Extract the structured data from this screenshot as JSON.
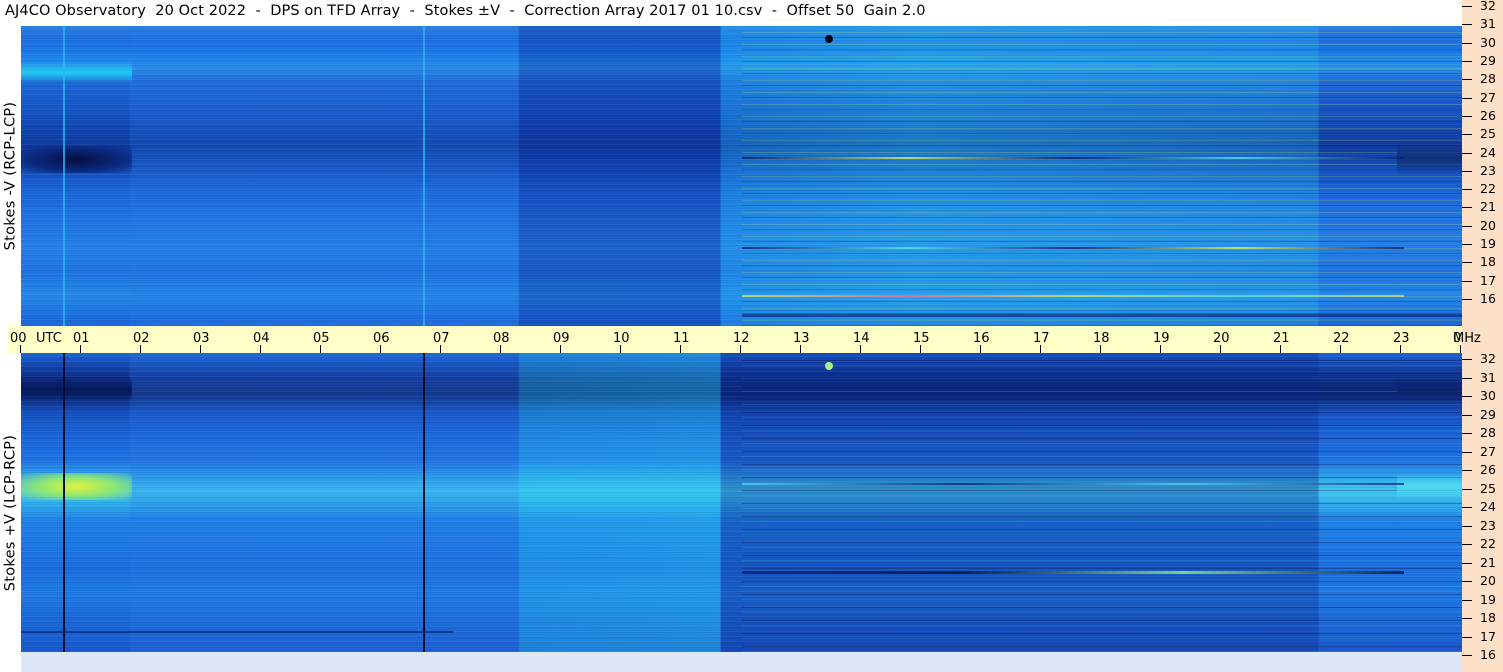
{
  "window": {
    "title": "AJ4CO Observatory  20 Oct 2022  -  DPS on TFD Array  -  Stokes ±V  -  Correction Array 2017 01 10.csv  -  Offset 50  Gain 2.0"
  },
  "panels": {
    "top": {
      "label": "Stokes -V (RCP-LCP)"
    },
    "bottom": {
      "label": "Stokes +V (LCP-RCP)"
    }
  },
  "time_axis": {
    "unit_label": "UTC",
    "freq_unit_label": "MHz",
    "hours": [
      "00",
      "01",
      "02",
      "03",
      "04",
      "05",
      "06",
      "07",
      "08",
      "09",
      "10",
      "11",
      "12",
      "13",
      "14",
      "15",
      "16",
      "17",
      "18",
      "19",
      "20",
      "21",
      "22",
      "23",
      "00"
    ]
  },
  "freq_axis": {
    "labels": [
      "32",
      "31",
      "30",
      "29",
      "28",
      "27",
      "26",
      "25",
      "24",
      "23",
      "22",
      "21",
      "20",
      "19",
      "18",
      "17",
      "16"
    ]
  },
  "colors": {
    "spectrogram_blue": "#1c6fe8",
    "dark_blue": "#0b1f7a",
    "cyan": "#10c8f0",
    "yellow_green": "#d8f040",
    "time_axis_bg": "#ffffc8",
    "freq_axis_bg": "#fde0c8"
  }
}
